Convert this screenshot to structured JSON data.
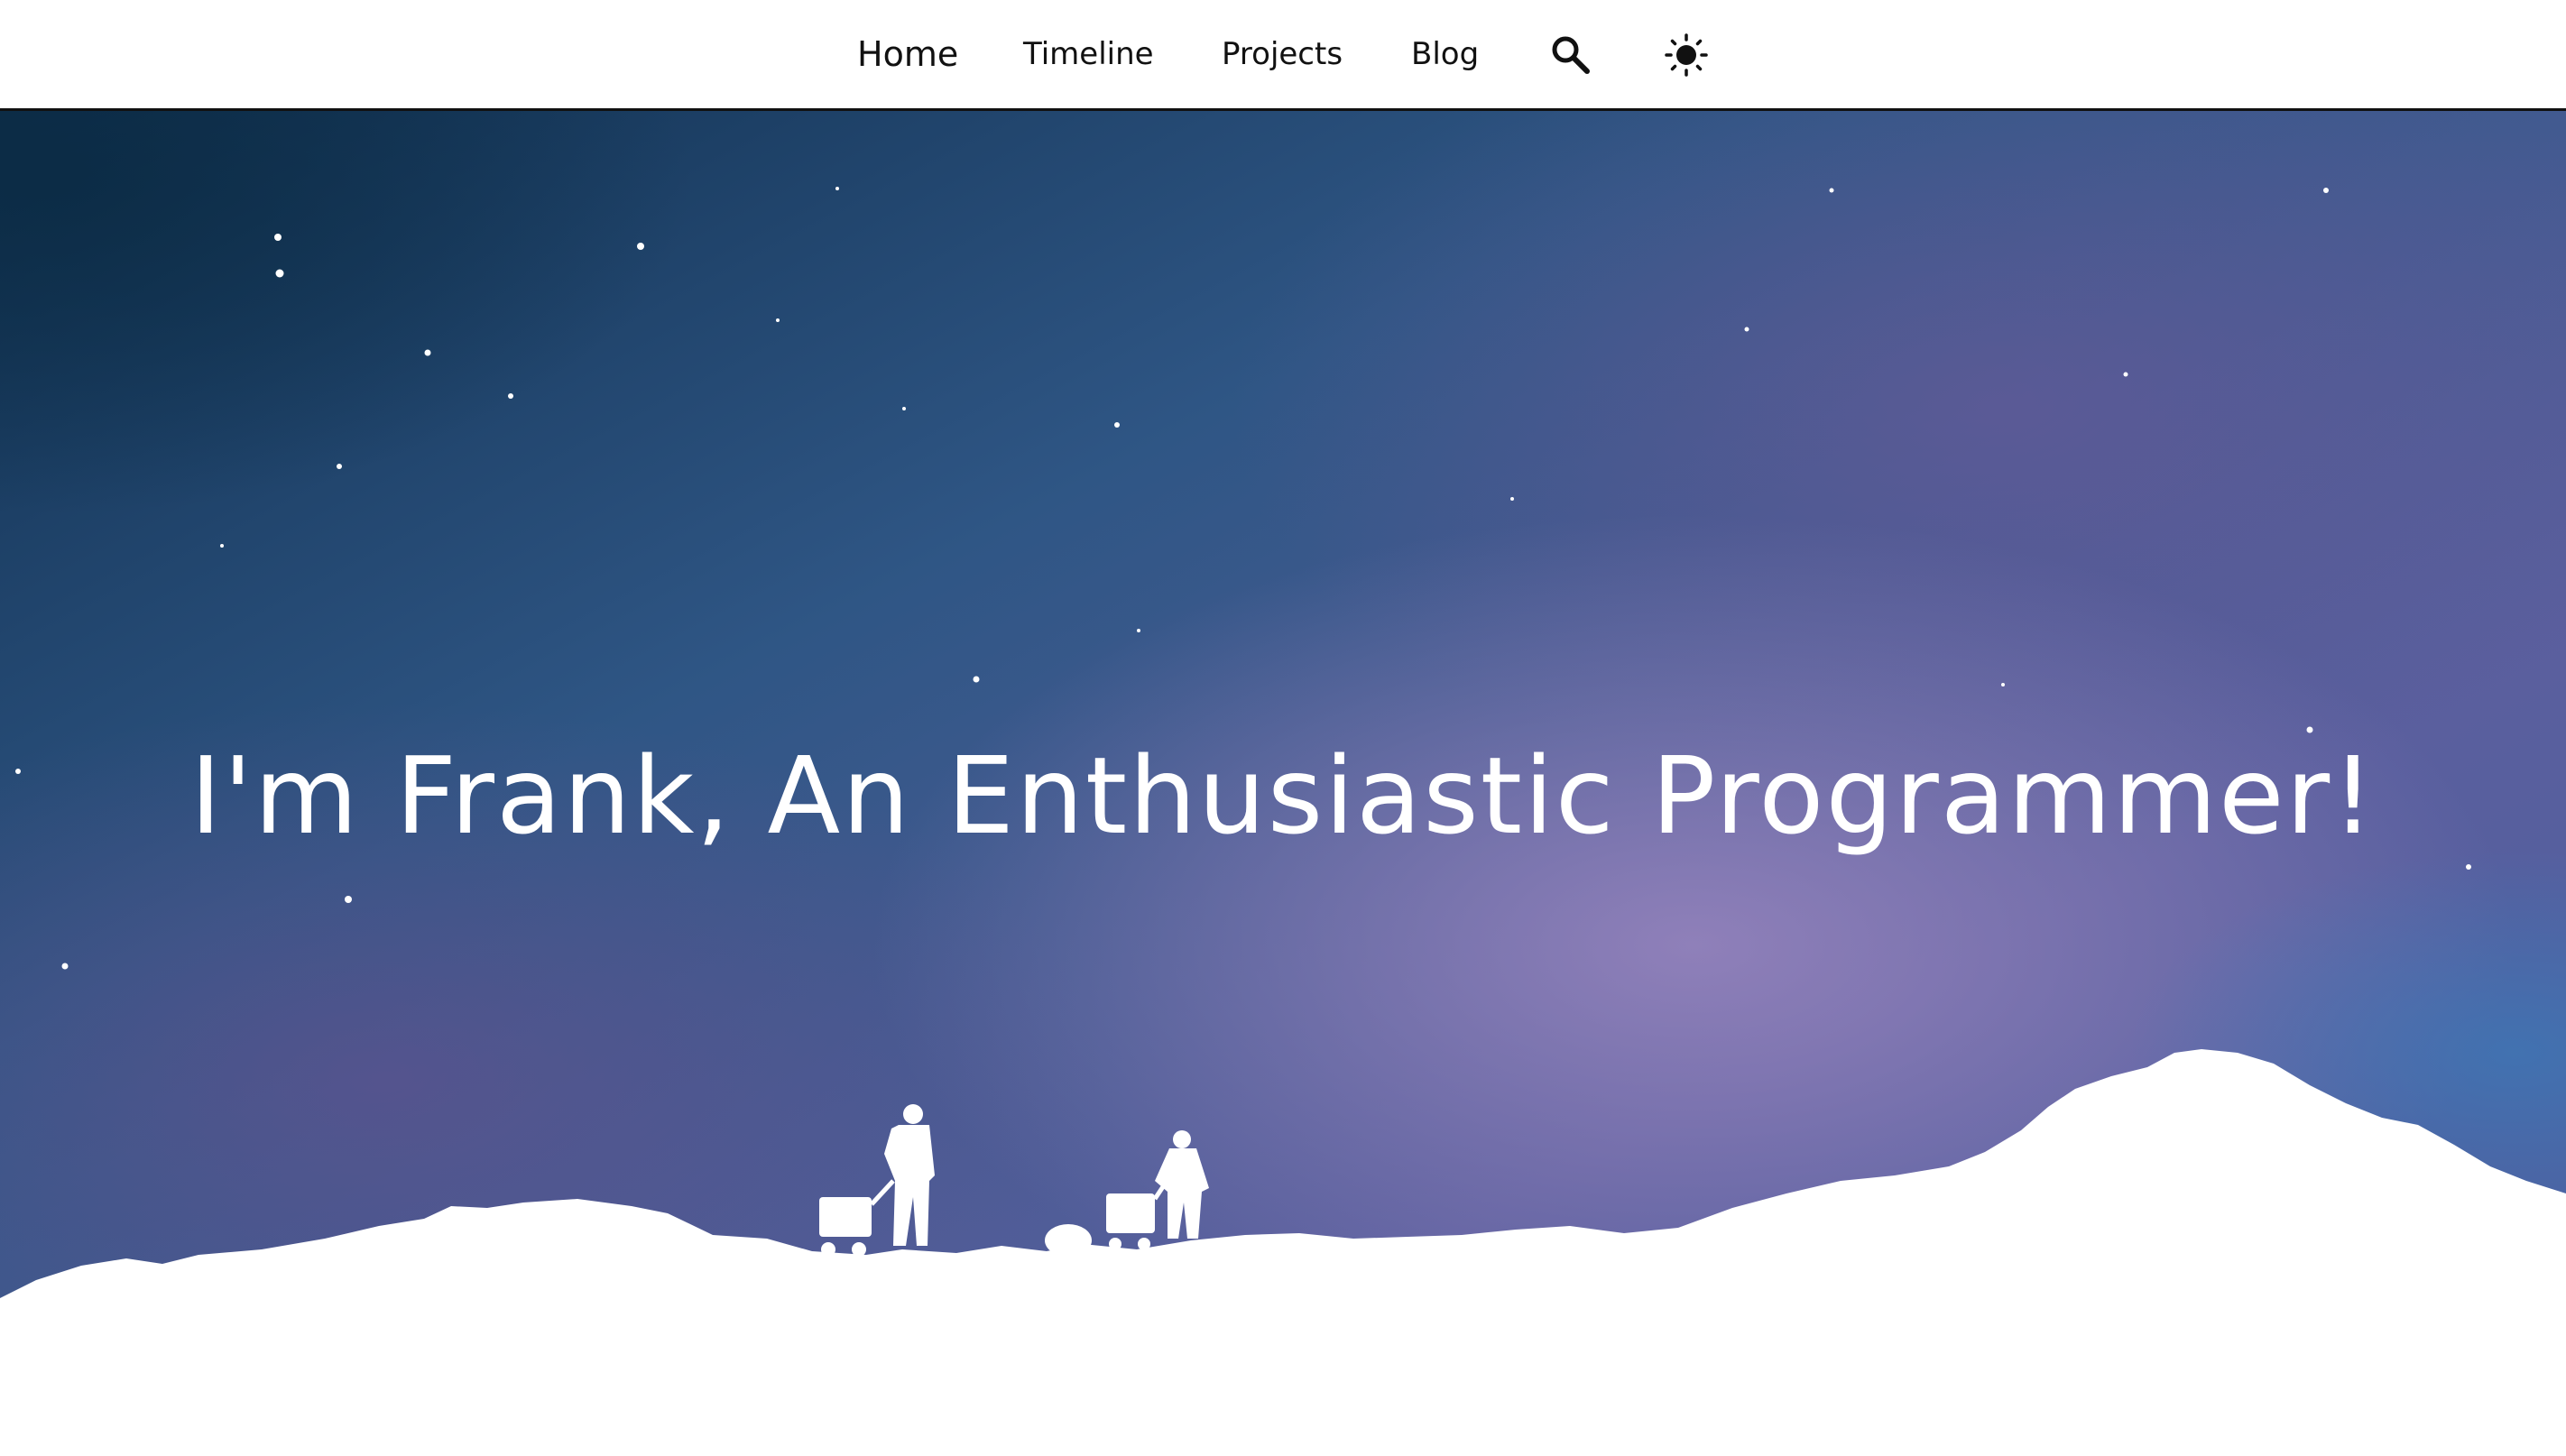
{
  "nav": {
    "items": [
      {
        "label": "Home"
      },
      {
        "label": "Timeline"
      },
      {
        "label": "Projects"
      },
      {
        "label": "Blog"
      }
    ],
    "search_icon": "search-icon",
    "theme_icon": "sun-icon"
  },
  "hero": {
    "title": "I'm Frank, An Enthusiastic Programmer!"
  },
  "colors": {
    "nav_bg": "#ffffff",
    "nav_text": "#111111",
    "sky_top": "#123a5c",
    "sky_mid": "#4a5a96",
    "sky_glow": "#8a78b4",
    "hero_text": "#ffffff",
    "snow": "#ffffff"
  }
}
